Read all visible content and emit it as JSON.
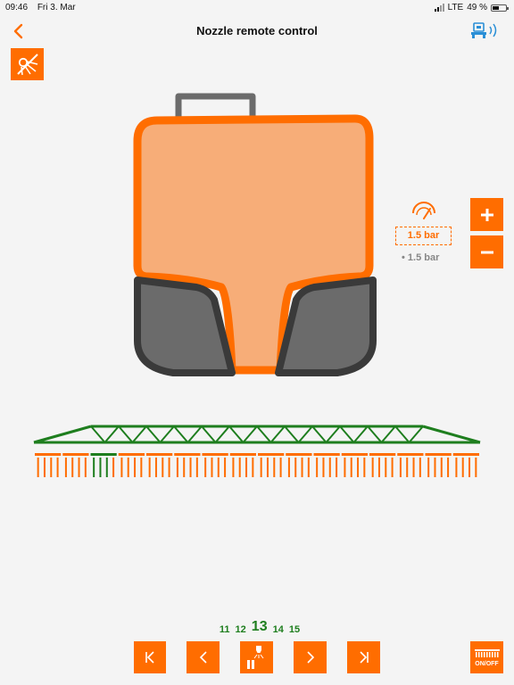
{
  "status": {
    "time": "09:46",
    "date": "Fri 3. Mar",
    "network": "LTE",
    "battery": "49 %",
    "battery_level": 0.49
  },
  "nav": {
    "title": "Nozzle remote control",
    "back_icon": "chevron-left-icon",
    "connection_icon": "terminal-connection-icon"
  },
  "toolbar": {
    "nozzle_toggle_icon": "nozzle-off-icon"
  },
  "pressure": {
    "icon": "pressure-gauge-icon",
    "current": "1.5  bar",
    "target": "• 1.5  bar",
    "plus_label": "+",
    "minus_label": "−"
  },
  "sections": {
    "items": [
      "11",
      "12",
      "13",
      "14",
      "15"
    ],
    "current_index": 2
  },
  "controls": {
    "first_icon": "skip-to-first-icon",
    "prev_icon": "previous-icon",
    "nozzle_icon": "nozzle-pause-icon",
    "next_icon": "next-icon",
    "last_icon": "skip-to-last-icon",
    "onoff_label": "ON/OFF"
  },
  "colors": {
    "accent": "#ff6d00",
    "tank_fill": "#f7ad78",
    "wheel_fill": "#6b6b6b",
    "boom_green": "#1e7e1e",
    "background": "#f4f4f4"
  }
}
